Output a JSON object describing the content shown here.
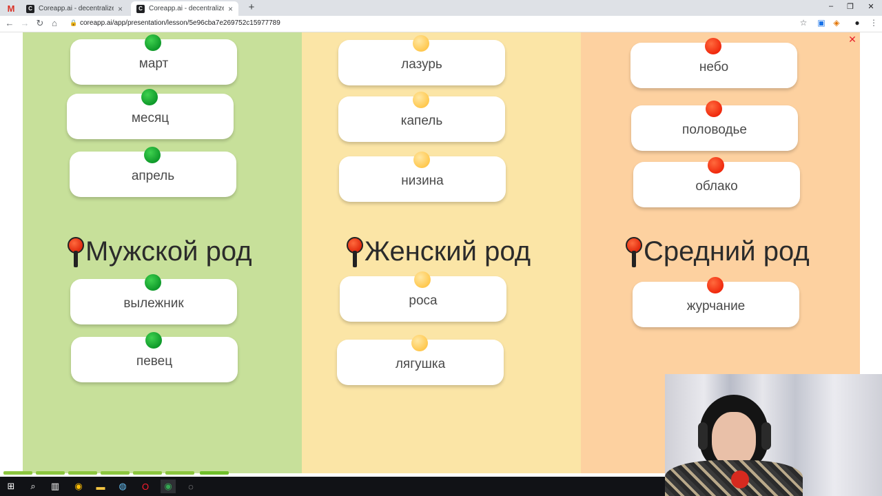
{
  "browser": {
    "tabs": [
      {
        "title": "Coreapp.ai - decentralized online"
      },
      {
        "title": "Coreapp.ai - decentralized online"
      }
    ],
    "gmail_letter": "M",
    "new_tab": "+",
    "url": "coreapp.ai/app/presentation/lesson/5e96cba7e269752c15977789"
  },
  "columns": [
    {
      "heading": "Мужской род",
      "pin_color": "#12a22f",
      "top_words": [
        "март",
        "месяц",
        "апрель"
      ],
      "bottom_words": [
        "вылежник",
        "певец"
      ]
    },
    {
      "heading": "Женский род",
      "pin_color": "#ffc84f",
      "top_words": [
        "лазурь",
        "капель",
        "низина"
      ],
      "bottom_words": [
        "роса",
        "лягушка"
      ]
    },
    {
      "heading": "Средний род",
      "pin_color": "#f0290d",
      "top_words": [
        "небо",
        "половодье",
        "облако"
      ],
      "bottom_words": [
        "журчание"
      ]
    }
  ],
  "colors": {
    "green_bg": "#c7e09a",
    "yellow_bg": "#fbe5a6",
    "orange_bg": "#fdd1a0",
    "progress": "#8cc63f"
  },
  "icons": {
    "close": "close-icon",
    "taskbar": [
      "windows-start-icon",
      "search-icon",
      "task-view-icon",
      "chrome-icon",
      "file-explorer-icon",
      "steam-icon",
      "opera-icon",
      "chrome-active-icon",
      "app-icon"
    ]
  }
}
